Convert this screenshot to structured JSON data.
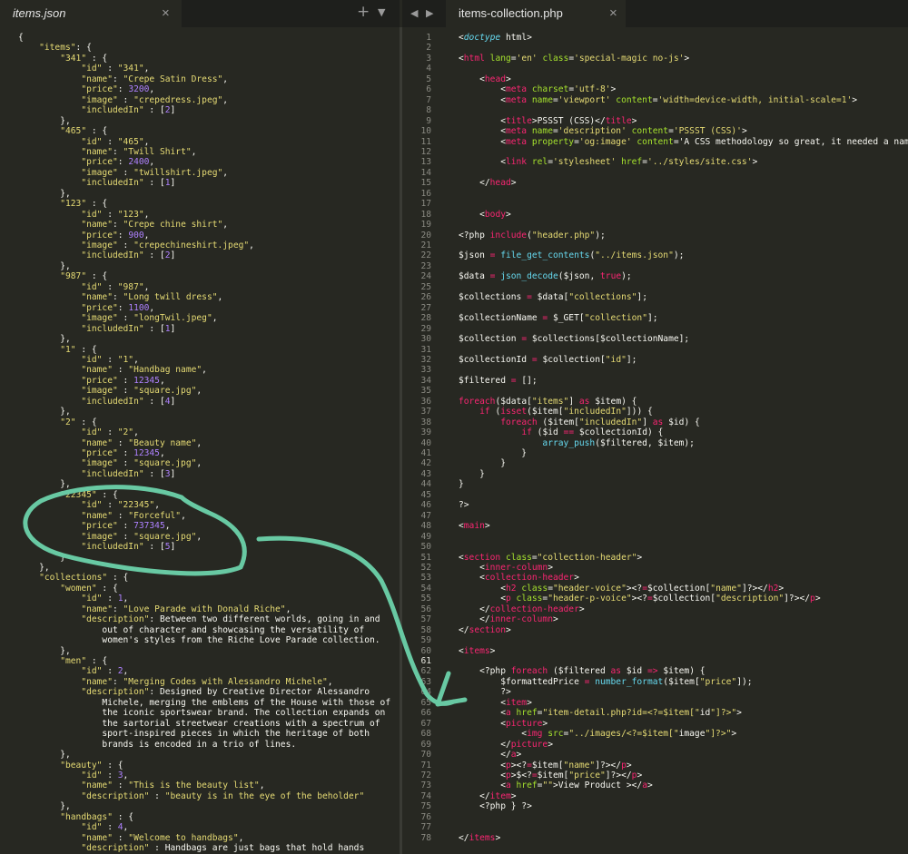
{
  "left_tab": {
    "title": "items.json",
    "close": "×"
  },
  "right_tab": {
    "title": "items-collection.php",
    "close": "×"
  },
  "tab_controls": {
    "plus": "+",
    "down": "▼",
    "prev": "◀",
    "next": "▶"
  },
  "left_lines": [
    "{",
    "    \"items\": {",
    "        \"341\" : {",
    "            \"id\" : \"341\",",
    "            \"name\": \"Crepe Satin Dress\",",
    "            \"price\": 3200,",
    "            \"image\" : \"crepedress.jpeg\",",
    "            \"includedIn\" : [2]",
    "        },",
    "        \"465\" : {",
    "            \"id\" : \"465\",",
    "            \"name\": \"Twill Shirt\",",
    "            \"price\": 2400,",
    "            \"image\" : \"twillshirt.jpeg\",",
    "            \"includedIn\" : [1]",
    "        },",
    "        \"123\" : {",
    "            \"id\" : \"123\",",
    "            \"name\": \"Crepe chine shirt\",",
    "            \"price\": 900,",
    "            \"image\" : \"crepechineshirt.jpeg\",",
    "            \"includedIn\" : [2]",
    "        },",
    "        \"987\" : {",
    "            \"id\" : \"987\",",
    "            \"name\": \"Long twill dress\",",
    "            \"price\": 1100,",
    "            \"image\" : \"longTwil.jpeg\",",
    "            \"includedIn\" : [1]",
    "        },",
    "        \"1\" : {",
    "            \"id\" : \"1\",",
    "            \"name\" : \"Handbag name\",",
    "            \"price\" : 12345,",
    "            \"image\" : \"square.jpg\",",
    "            \"includedIn\" : [4]",
    "        },",
    "        \"2\" : {",
    "            \"id\" : \"2\",",
    "            \"name\" : \"Beauty name\",",
    "            \"price\" : 12345,",
    "            \"image\" : \"square.jpg\",",
    "            \"includedIn\" : [3]",
    "        },",
    "        \"22345\" : {",
    "            \"id\" : \"22345\",",
    "            \"name\" : \"Forceful\",",
    "            \"price\" : 737345,",
    "            \"image\" : \"square.jpg\",",
    "            \"includedIn\" : [5]",
    "        }",
    "    },",
    "    \"collections\" : {",
    "        \"women\" : {",
    "            \"id\" : 1,",
    "            \"name\": \"Love Parade with Donald Riche\",",
    "            \"description\": \"Between two different worlds, going in and",
    "                out of character and showcasing the versatility of",
    "                women's styles from the Riche Love Parade collection.\"",
    "        },",
    "        \"men\" : {",
    "            \"id\" : 2,",
    "            \"name\": \"Merging Codes with Alessandro Michele\",",
    "            \"description\": \"Designed by Creative Director Alessandro",
    "                Michele, merging the emblems of the House with those of",
    "                the iconic sportswear brand. The collection expands on",
    "                the sartorial streetwear creations with a spectrum of",
    "                sport-inspired pieces in which the heritage of both",
    "                brands is encoded in a trio of lines. \"",
    "        },",
    "        \"beauty\" : {",
    "            \"id\" : 3,",
    "            \"name\" : \"This is the beauty list\",",
    "            \"description\" : \"beauty is in the eye of the beholder\"",
    "        },",
    "        \"handbags\" : {",
    "            \"id\" : 4,",
    "            \"name\" : \"Welcome to handbags\",",
    "            \"description\" : \"Handbags are just bags that hold hands"
  ],
  "right_lines": [
    "<!doctype html>",
    "",
    "<html lang='en' class='special-magic no-js'>",
    "",
    "    <head>",
    "        <meta charset='utf-8'>",
    "        <meta name='viewport' content='width=device-width, initial-scale=1'>",
    "",
    "        <title>PSSST (CSS)</title>",
    "        <meta name='description' content='PSSST (CSS)'>",
    "        <meta property='og:image' content='A CSS methodology so great, it needed a nam",
    "",
    "        <link rel='stylesheet' href='../styles/site.css'>",
    "",
    "    </head>",
    "",
    "",
    "    <body>",
    "",
    "<?php include(\"header.php\");",
    "",
    "$json = file_get_contents(\"../items.json\");",
    "",
    "$data = json_decode($json, true);",
    "",
    "$collections = $data[\"collections\"];",
    "",
    "$collectionName = $_GET[\"collection\"];",
    "",
    "$collection = $collections[$collectionName];",
    "",
    "$collectionId = $collection[\"id\"];",
    "",
    "$filtered = [];",
    "",
    "foreach($data[\"items\"] as $item) {",
    "    if (isset($item[\"includedIn\"])) {",
    "        foreach ($item[\"includedIn\"] as $id) {",
    "            if ($id == $collectionId) {",
    "                array_push($filtered, $item);",
    "            }",
    "        }",
    "    }",
    "}",
    "",
    "?>",
    "",
    "<main>",
    "",
    "",
    "<section class=\"collection-header\">",
    "    <inner-column>",
    "    <collection-header>",
    "        <h2 class=\"header-voice\"><?=$collection[\"name\"]?></h2>",
    "        <p class=\"header-p-voice\"><?=$collection[\"description\"]?></p>",
    "    </collection-header>",
    "    </inner-column>",
    "</section>",
    "",
    "<items>",
    "",
    "    <?php foreach ($filtered as $id => $item) {",
    "        $formattedPrice = number_format($item[\"price\"]);",
    "        ?>",
    "        <item>",
    "        <a href=\"item-detail.php?id=<?=$item[\"id\"]?>\">",
    "        <picture>",
    "            <img src=\"../images/<?=$item[\"image\"]?>\">",
    "        </picture>",
    "        </a>",
    "        <p><?=$item[\"name\"]?></p>",
    "        <p>$<?=$item[\"price\"]?></p>",
    "        <a href=\"\">View Product ></a>",
    "    </item>",
    "    <?php } ?>",
    "",
    "",
    "</items>"
  ],
  "right_line_numbers": [
    "1",
    "2",
    "3",
    "4",
    "5",
    "6",
    "7",
    "8",
    "9",
    "10",
    "11",
    "12",
    "13",
    "14",
    "15",
    "16",
    "17",
    "18",
    "19",
    "20",
    "21",
    "22",
    "23",
    "24",
    "25",
    "26",
    "27",
    "28",
    "29",
    "30",
    "31",
    "32",
    "33",
    "34",
    "35",
    "36",
    "37",
    "38",
    "39",
    "40",
    "41",
    "42",
    "43",
    "44",
    "45",
    "46",
    "47",
    "48",
    "49",
    "50",
    "51",
    "52",
    "53",
    "54",
    "55",
    "56",
    "57",
    "58",
    "59",
    "60",
    "61",
    "62",
    "63",
    "64",
    "65",
    "66",
    "67",
    "68",
    "69",
    "70",
    "71",
    "72",
    "73",
    "74",
    "75",
    "76",
    "77",
    "78"
  ],
  "annotation": {
    "color": "#68c9a3"
  }
}
